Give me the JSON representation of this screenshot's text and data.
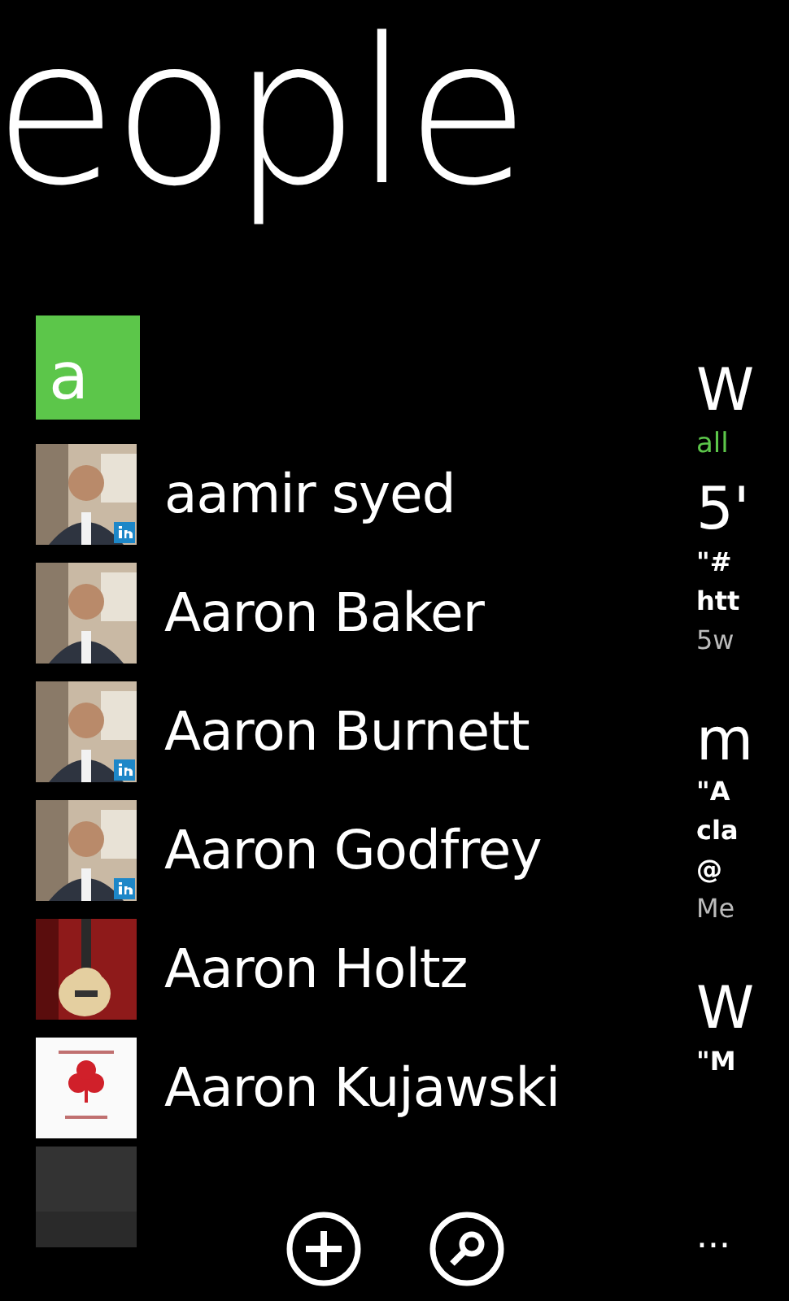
{
  "title": "eople",
  "group_tile": {
    "letter": "a"
  },
  "contacts": [
    {
      "name": "aamir syed",
      "linked": true
    },
    {
      "name": "Aaron Baker",
      "linked": false
    },
    {
      "name": "Aaron Burnett",
      "linked": true
    },
    {
      "name": "Aaron Godfrey",
      "linked": true
    },
    {
      "name": "Aaron Holtz",
      "linked": false
    },
    {
      "name": "Aaron Kujawski",
      "linked": false
    }
  ],
  "whats_new": [
    {
      "kind": "heading",
      "text": "W"
    },
    {
      "kind": "filter",
      "text": "all"
    },
    {
      "kind": "heading",
      "text": "5'"
    },
    {
      "kind": "post",
      "text": "\"#"
    },
    {
      "kind": "post",
      "text": "htt"
    },
    {
      "kind": "meta",
      "text": "5w"
    },
    {
      "kind": "heading",
      "text": "m"
    },
    {
      "kind": "post",
      "text": "\"A"
    },
    {
      "kind": "post",
      "text": "cla"
    },
    {
      "kind": "post",
      "text": "@"
    },
    {
      "kind": "meta",
      "text": "Me"
    },
    {
      "kind": "heading",
      "text": "W"
    },
    {
      "kind": "post",
      "text": "\"M"
    }
  ],
  "app_bar": {
    "buttons": [
      {
        "kind": "add"
      },
      {
        "kind": "search"
      }
    ],
    "more": "..."
  }
}
